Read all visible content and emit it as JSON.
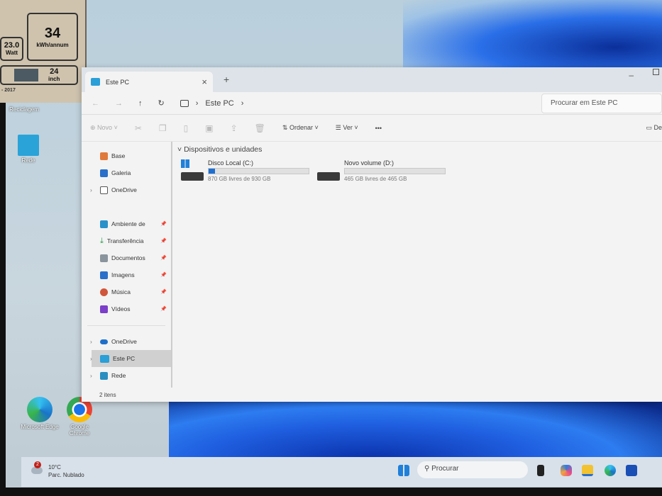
{
  "energy_label": {
    "kwh": "34",
    "kwh_unit": "kWh/annum",
    "watt": "23.0",
    "watt_unit": "Watt",
    "size": "24",
    "size_unit": "inch",
    "year": "- 2017"
  },
  "desktop": {
    "icons": [
      {
        "label": "Reciclagem"
      },
      {
        "label": "Rede"
      },
      {
        "label": "Microsoft Edge"
      },
      {
        "label": "Google Chrome"
      }
    ]
  },
  "explorer": {
    "tab_title": "Este PC",
    "new_tab": "+",
    "close": "×",
    "breadcrumb": [
      "Este PC"
    ],
    "search_placeholder": "Procurar em Este PC",
    "toolbar": {
      "new": "Novo",
      "sort": "Ordenar",
      "view": "Ver",
      "more": "•••",
      "details": "De"
    },
    "sidebar": {
      "top": [
        {
          "label": "Base"
        },
        {
          "label": "Galeria"
        },
        {
          "label": "OneDrive"
        }
      ],
      "pinned": [
        {
          "label": "Ambiente de"
        },
        {
          "label": "Transferência"
        },
        {
          "label": "Documentos"
        },
        {
          "label": "Imagens"
        },
        {
          "label": "Música"
        },
        {
          "label": "Vídeos"
        }
      ],
      "bottom": [
        {
          "label": "OneDrive"
        },
        {
          "label": "Este PC"
        },
        {
          "label": "Rede"
        }
      ]
    },
    "section_title": "Dispositivos e unidades",
    "drives": [
      {
        "name": "Disco Local (C:)",
        "free": "870 GB livres de 930 GB",
        "used_fraction": 0.065
      },
      {
        "name": "Novo volume (D:)",
        "free": "465 GB livres de 465 GB",
        "used_fraction": 0.0
      }
    ],
    "status": "2 itens"
  },
  "taskbar": {
    "weather_temp": "10°C",
    "weather_desc": "Parc. Nublado",
    "weather_badge": "2",
    "search": "Procurar"
  }
}
